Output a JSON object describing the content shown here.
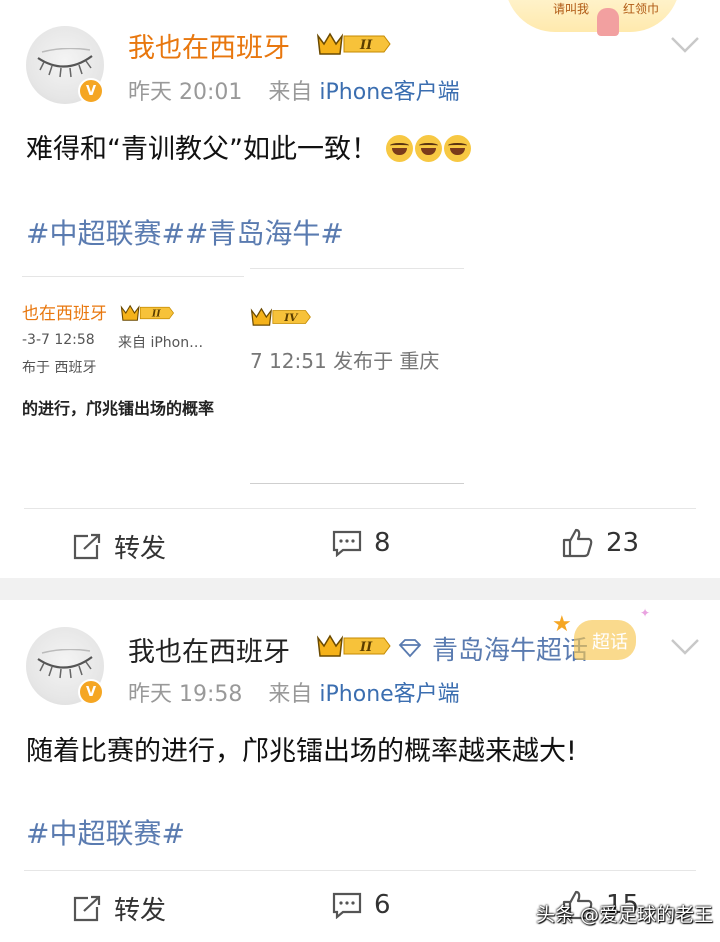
{
  "posts": [
    {
      "username": "我也在西班牙",
      "level": "II",
      "time": "昨天 20:01",
      "source_prefix": "来自",
      "source_app": "iPhone客户端",
      "text": "难得和“青训教父”如此一致！",
      "tags": "#中超联赛##青岛海牛#",
      "actions": {
        "repost": "转发",
        "comments": "8",
        "likes": "23"
      },
      "embedded": {
        "left": {
          "username": "也在西班牙",
          "level": "II",
          "time": "-3-7 12:58",
          "source": "来自 iPhon…",
          "location": "布于 西班牙",
          "text": "的进行，邝兆镭出场的概率"
        },
        "right": {
          "level": "IV",
          "time_location": "7 12:51  发布于 重庆"
        }
      }
    },
    {
      "username": "我也在西班牙",
      "level": "II",
      "topic": "青岛海牛超话",
      "topic_badge": "超话",
      "time": "昨天 19:58",
      "source_prefix": "来自",
      "source_app": "iPhone客户端",
      "text": "随着比赛的进行，邝兆镭出场的概率越来越大!",
      "tags": "#中超联赛#",
      "actions": {
        "repost": "转发",
        "comments": "6",
        "likes": "15"
      }
    }
  ],
  "banner": {
    "left": "请叫我",
    "right": "红领巾"
  },
  "watermark": "头条 @爱足球的老王",
  "icons": [
    "v-badge-icon",
    "crown-icon",
    "chevron-down-icon",
    "repost-icon",
    "comment-icon",
    "like-icon",
    "diamond-icon",
    "laugh-cry-emoji"
  ],
  "colors": {
    "name_orange": "#e8770e",
    "link_blue": "#5a7bb0",
    "meta_gray": "#999999",
    "badge_gold": "#f5b21a"
  }
}
